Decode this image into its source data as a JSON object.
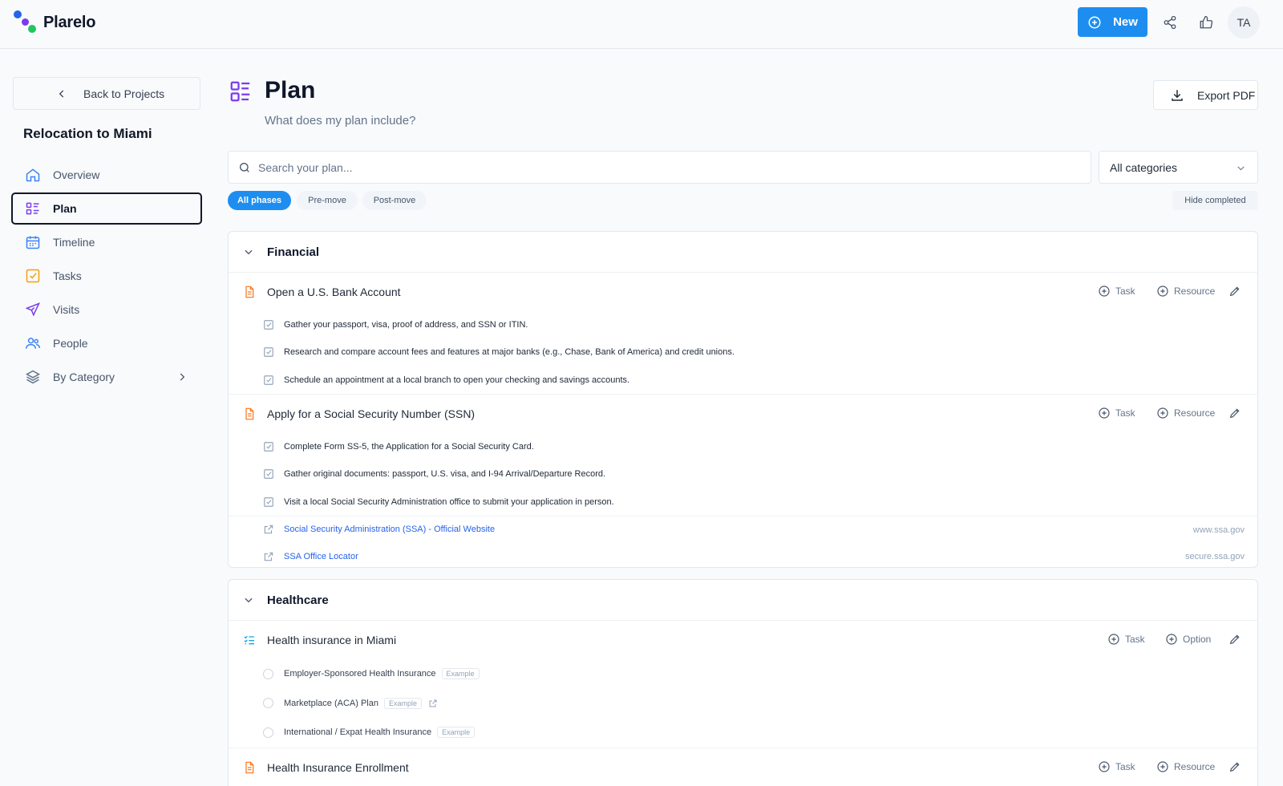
{
  "app": {
    "brand": "Plarelo",
    "new_label": "New",
    "avatar_initials": "TA",
    "accent_color": "#1d8ef0"
  },
  "sidebar": {
    "back_label": "Back to Projects",
    "project_title": "Relocation to Miami",
    "items": [
      {
        "label": "Overview",
        "icon": "home-icon"
      },
      {
        "label": "Plan",
        "icon": "list-icon",
        "active": true
      },
      {
        "label": "Timeline",
        "icon": "calendar-icon"
      },
      {
        "label": "Tasks",
        "icon": "check-square-icon"
      },
      {
        "label": "Visits",
        "icon": "plane-icon"
      },
      {
        "label": "People",
        "icon": "users-icon"
      },
      {
        "label": "By Category",
        "icon": "layers-icon"
      }
    ]
  },
  "main": {
    "title": "Plan",
    "subtitle": "What does my plan include?",
    "export_label": "Export PDF",
    "search_placeholder": "Search your plan...",
    "category_select": "All categories",
    "phases": [
      "All phases",
      "Pre-move",
      "Post-move"
    ],
    "hide_completed": "Hide completed",
    "actions": {
      "task": "Task",
      "resource": "Resource",
      "option": "Option"
    }
  },
  "sections": [
    {
      "title": "Financial",
      "items": [
        {
          "title": "Open a U.S. Bank Account",
          "tasks": [
            "Gather your passport, visa, proof of address, and SSN or ITIN.",
            "Research and compare account fees and features at major banks (e.g., Chase, Bank of America) and credit unions.",
            "Schedule an appointment at a local branch to open your checking and savings accounts."
          ]
        },
        {
          "title": "Apply for a Social Security Number (SSN)",
          "tasks": [
            "Complete Form SS-5, the Application for a Social Security Card.",
            "Gather original documents: passport, U.S. visa, and I-94 Arrival/Departure Record.",
            "Visit a local Social Security Administration office to submit your application in person."
          ],
          "resources": [
            {
              "label": "Social Security Administration (SSA) - Official Website",
              "domain": "www.ssa.gov"
            },
            {
              "label": "SSA Office Locator",
              "domain": "secure.ssa.gov"
            }
          ]
        }
      ]
    },
    {
      "title": "Healthcare",
      "items": [
        {
          "title": "Health insurance in Miami",
          "options": [
            {
              "label": "Employer-Sponsored Health Insurance",
              "tag": "Example"
            },
            {
              "label": "Marketplace (ACA) Plan",
              "tag": "Example"
            },
            {
              "label": "International / Expat Health Insurance",
              "tag": "Example"
            }
          ]
        },
        {
          "title": "Health Insurance Enrollment"
        }
      ]
    }
  ]
}
